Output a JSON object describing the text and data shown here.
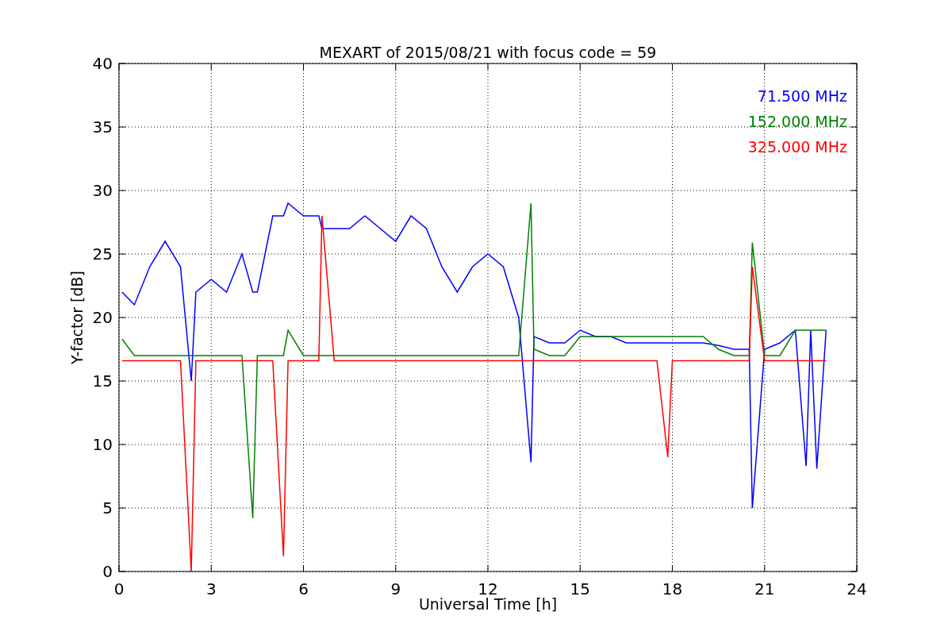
{
  "chart_data": {
    "type": "line",
    "title": "MEXART of 2015/08/21 with focus code = 59",
    "xlabel": "Universal Time [h]",
    "ylabel": "Y-factor [dB]",
    "x": [
      0.1,
      0.5,
      1,
      1.5,
      2,
      2.35,
      2.5,
      3,
      3.5,
      4,
      4.35,
      4.5,
      5,
      5.35,
      5.5,
      6,
      6.5,
      6.6,
      7,
      7.5,
      8,
      8.5,
      9,
      9.5,
      10,
      10.5,
      11,
      11.5,
      12,
      12.5,
      13,
      13.4,
      13.5,
      14,
      14.5,
      15,
      15.5,
      16,
      16.5,
      17,
      17.5,
      17.85,
      18,
      18.5,
      19,
      19.5,
      20,
      20.5,
      20.6,
      21,
      21.5,
      22,
      22.35,
      22.5,
      22.7,
      23
    ],
    "series": [
      {
        "name": "71.500 MHz",
        "color": "#0000ff",
        "values": [
          22,
          21,
          24,
          26,
          24,
          15,
          22,
          23,
          22,
          25,
          22,
          22,
          28,
          28,
          29,
          28,
          28,
          27,
          27,
          27,
          28,
          27,
          26,
          28,
          27,
          24,
          22,
          24,
          25,
          24,
          20,
          8.6,
          18.5,
          18,
          18,
          19,
          18.5,
          18.5,
          18,
          18,
          18,
          18,
          18,
          18,
          18,
          17.8,
          17.5,
          17.5,
          5,
          17.5,
          18,
          19,
          8.3,
          19,
          8.1,
          19
        ]
      },
      {
        "name": "152.000 MHz",
        "color": "#008000",
        "values": [
          18.3,
          17,
          17,
          17,
          17,
          17,
          17,
          17,
          17,
          17,
          4.2,
          17,
          17,
          17,
          19,
          17,
          17,
          17,
          17,
          17,
          17,
          17,
          17,
          17,
          17,
          17,
          17,
          17,
          17,
          17,
          17,
          29,
          17.5,
          17,
          17,
          18.5,
          18.5,
          18.5,
          18.5,
          18.5,
          18.5,
          18.5,
          18.5,
          18.5,
          18.5,
          17.5,
          17,
          17,
          25.9,
          17,
          17,
          19,
          19,
          19,
          19,
          19
        ]
      },
      {
        "name": "325.000 MHz",
        "color": "#ff0000",
        "values": [
          16.6,
          16.6,
          16.6,
          16.6,
          16.6,
          0,
          16.6,
          16.6,
          16.6,
          16.6,
          16.6,
          16.6,
          16.6,
          1.2,
          16.6,
          16.6,
          16.6,
          28,
          16.6,
          16.6,
          16.6,
          16.6,
          16.6,
          16.6,
          16.6,
          16.6,
          16.6,
          16.6,
          16.6,
          16.6,
          16.6,
          16.6,
          16.6,
          16.6,
          16.6,
          16.6,
          16.6,
          16.6,
          16.6,
          16.6,
          16.6,
          9,
          16.6,
          16.6,
          16.6,
          16.6,
          16.6,
          16.6,
          24,
          16.6,
          16.6,
          16.6,
          16.6,
          16.6,
          16.6,
          16.6
        ]
      }
    ],
    "grid": true,
    "xlim": [
      0,
      24
    ],
    "ylim": [
      0,
      40
    ],
    "xticks": [
      0,
      3,
      6,
      9,
      12,
      15,
      18,
      21,
      24
    ],
    "yticks": [
      0,
      5,
      10,
      15,
      20,
      25,
      30,
      35,
      40
    ]
  }
}
